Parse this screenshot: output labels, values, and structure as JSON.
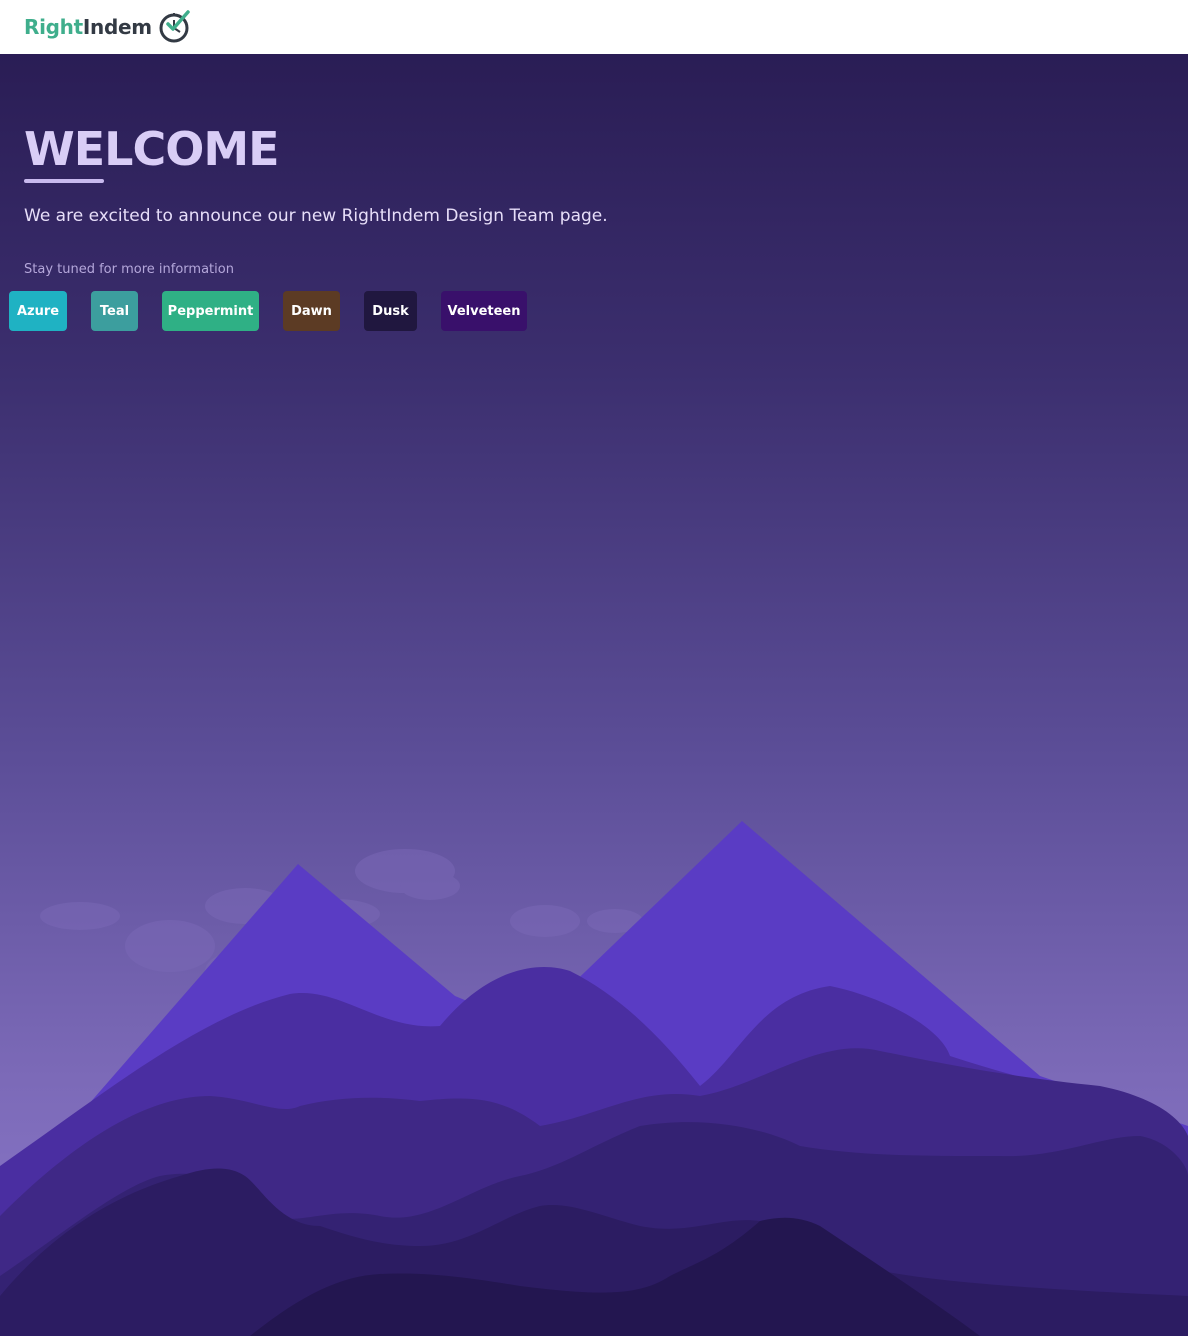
{
  "header": {
    "logo_right": "Right",
    "logo_indem": "Indem",
    "logo_icon": "clock-check-icon"
  },
  "hero": {
    "title": "WELCOME",
    "lead": "We are excited to announce our new RightIndem Design Team page.",
    "subtext": "Stay tuned for more information"
  },
  "swatches": [
    {
      "label": "Azure",
      "color": "#1fb2c3"
    },
    {
      "label": "Teal",
      "color": "#3c9e9e"
    },
    {
      "label": "Peppermint",
      "color": "#2fb085"
    },
    {
      "label": "Dawn",
      "color": "#5c3b24"
    },
    {
      "label": "Dusk",
      "color": "#20173f"
    },
    {
      "label": "Velveteen",
      "color": "#39106b"
    }
  ],
  "colors": {
    "brand_green": "#3fae8c",
    "brand_dark": "#333a44",
    "mountain_peak": "#5a3cc4"
  }
}
